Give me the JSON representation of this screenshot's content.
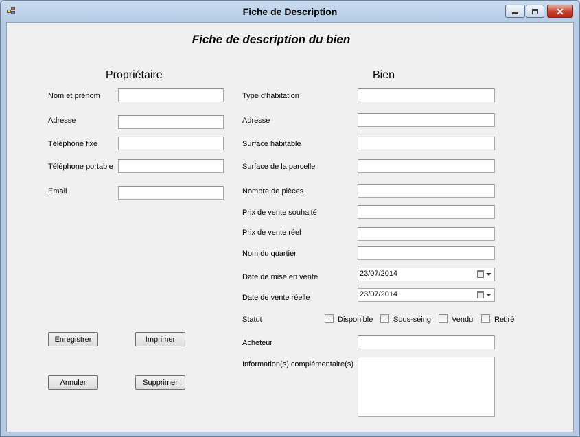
{
  "window": {
    "title": "Fiche de Description",
    "icon": "app-form-icon",
    "controls": [
      "minimize-icon",
      "maximize-icon",
      "close-icon"
    ]
  },
  "form": {
    "heading": "Fiche de description du bien",
    "owner": {
      "section_title": "Propriétaire",
      "name_label": "Nom et prénom",
      "name_value": "",
      "address_label": "Adresse",
      "address_value": "",
      "phone_label": "Téléphone fixe",
      "phone_value": "",
      "mobile_label": "Téléphone portable",
      "mobile_value": "",
      "email_label": "Email",
      "email_value": ""
    },
    "property": {
      "section_title": "Bien",
      "type_label": "Type d'habitation",
      "type_value": "",
      "address_label": "Adresse",
      "address_value": "",
      "living_area_label": "Surface habitable",
      "living_area_value": "",
      "plot_area_label": "Surface de la parcelle",
      "plot_area_value": "",
      "rooms_label": "Nombre de pièces",
      "rooms_value": "",
      "desired_price_label": "Prix de vente souhaité",
      "desired_price_value": "",
      "real_price_label": "Prix de vente réel",
      "real_price_value": "",
      "district_label": "Nom du quartier",
      "district_value": "",
      "listing_date_label": "Date de mise en vente",
      "listing_date_value": "23/07/2014",
      "sale_date_label": "Date de vente réelle",
      "sale_date_value": "23/07/2014",
      "status_label": "Statut",
      "status_options": [
        "Disponible",
        "Sous-seing",
        "Vendu",
        "Retiré"
      ],
      "buyer_label": "Acheteur",
      "buyer_value": "",
      "info_label": "Information(s) complémentaire(s)",
      "info_value": ""
    },
    "buttons": {
      "save": "Enregistrer",
      "print": "Imprimer",
      "cancel": "Annuler",
      "delete": "Supprimer"
    }
  }
}
